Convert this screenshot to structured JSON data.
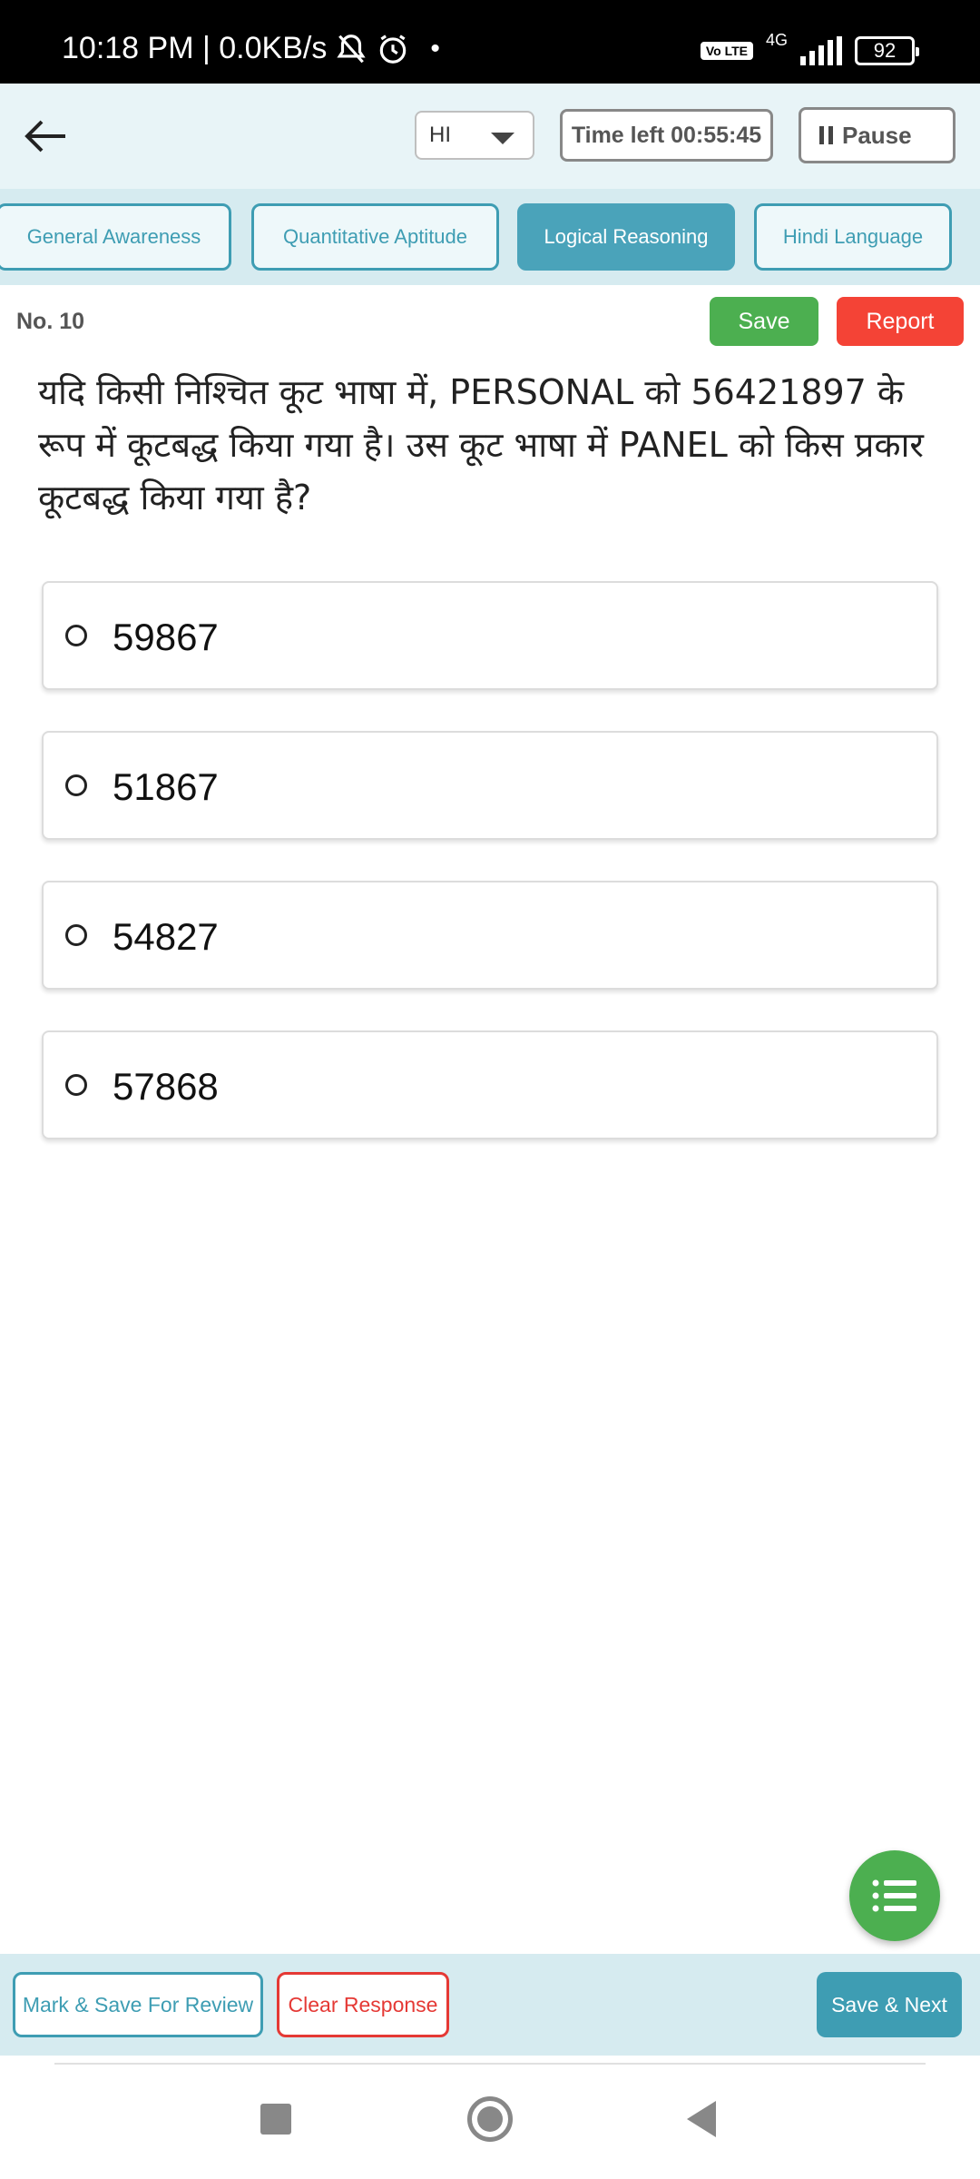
{
  "status_bar": {
    "time_speed": "10:18 PM | 0.0KB/s",
    "network": "4G",
    "volte": "Vo LTE",
    "battery": "92"
  },
  "header": {
    "language": "HI",
    "time_left": "Time left 00:55:45",
    "pause_label": "Pause"
  },
  "tabs": [
    {
      "label": "General Awareness",
      "active": false
    },
    {
      "label": "Quantitative Aptitude",
      "active": false
    },
    {
      "label": "Logical Reasoning",
      "active": true
    },
    {
      "label": "Hindi Language",
      "active": false
    }
  ],
  "question": {
    "number": "No. 10",
    "save_label": "Save",
    "report_label": "Report",
    "text": "यदि किसी निश्चित कूट भाषा में, PERSONAL को 56421897 के रूप में कूटबद्ध किया गया है। उस कूट भाषा में PANEL को किस प्रकार कूटबद्ध किया गया है?",
    "options": [
      "59867",
      "51867",
      "54827",
      "57868"
    ]
  },
  "footer": {
    "mark_review_label": "Mark & Save For Review",
    "clear_label": "Clear Response",
    "save_next_label": "Save & Next"
  },
  "colors": {
    "accent": "#3e9db3",
    "save": "#4caf50",
    "report": "#f44336"
  }
}
